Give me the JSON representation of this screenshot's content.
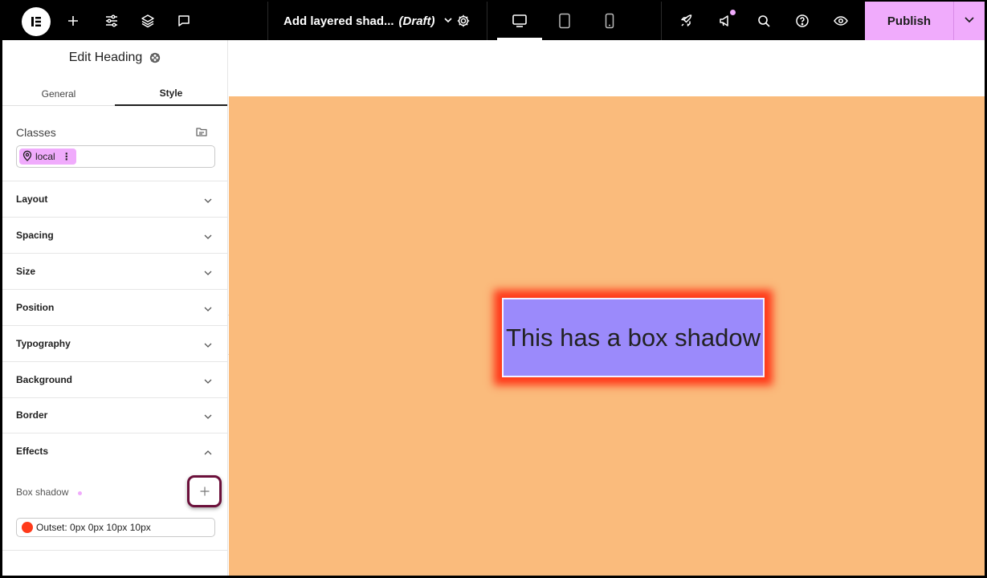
{
  "topbar": {
    "document_title": "Add layered shad...",
    "document_status": "(Draft)",
    "publish_label": "Publish",
    "colors": {
      "background": "#000000",
      "accent": "#f0abfc"
    },
    "icons": {
      "logo": "elementor-logo-icon",
      "add": "plus-icon",
      "settings": "sliders-icon",
      "structure": "layers-icon",
      "notes": "comment-icon",
      "page_settings": "gear-icon",
      "desktop": "desktop-icon",
      "tablet": "tablet-icon",
      "mobile": "mobile-icon",
      "launch": "rocket-icon",
      "whats_new": "megaphone-icon",
      "finder": "search-icon",
      "help": "help-circle-icon",
      "preview": "eye-icon"
    }
  },
  "panel": {
    "title": "Edit Heading",
    "tabs": [
      {
        "label": "General",
        "active": false
      },
      {
        "label": "Style",
        "active": true
      }
    ],
    "classes": {
      "label": "Classes",
      "chip_label": "local"
    },
    "sections": [
      {
        "label": "Layout",
        "expanded": false
      },
      {
        "label": "Spacing",
        "expanded": false
      },
      {
        "label": "Size",
        "expanded": false
      },
      {
        "label": "Position",
        "expanded": false
      },
      {
        "label": "Typography",
        "expanded": false
      },
      {
        "label": "Background",
        "expanded": false
      },
      {
        "label": "Border",
        "expanded": false
      }
    ],
    "effects": {
      "label": "Effects",
      "expanded": true,
      "box_shadow_label": "Box shadow",
      "shadow_items": [
        {
          "label": "Outset: 0px 0px 10px 10px",
          "color": "#ff3a1a"
        }
      ]
    }
  },
  "canvas": {
    "section_color": "#fabb7c",
    "heading_text": "This has a box shadow",
    "heading_background": "#9b8afb",
    "heading_shadow_color": "#ff3a1a"
  }
}
